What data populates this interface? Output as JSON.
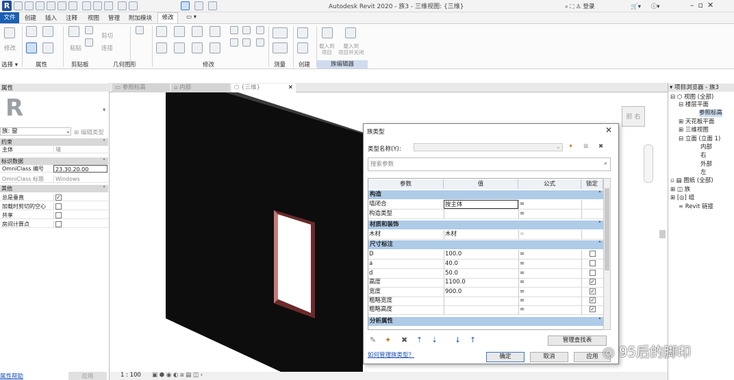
{
  "app": {
    "title": "Autodesk Revit 2020 - 族3 - 三维视图: {三维}",
    "user": "登录"
  },
  "menu": {
    "file": "文件",
    "items": [
      "创建",
      "插入",
      "注释",
      "视图",
      "管理",
      "附加模块"
    ],
    "active": "修改"
  },
  "ribbon": {
    "groups": [
      "选择",
      "属性",
      "剪贴板",
      "几何图形",
      "修改",
      "测量",
      "创建",
      "族编辑器"
    ],
    "labels": {
      "modify": "修改",
      "paste": "粘贴",
      "cut": "剪切",
      "join": "连接",
      "load_project": "载入到\n项目",
      "load_close": "载入到\n项目并关闭"
    }
  },
  "properties": {
    "header": "属性",
    "type_selector": "族: 窗",
    "edit_type": "编辑类型",
    "groups": [
      {
        "name": "约束",
        "rows": [
          {
            "k": "主体",
            "v": "墙"
          }
        ]
      },
      {
        "name": "标识数据",
        "rows": [
          {
            "k": "OmniClass 编号",
            "v": "23.30.20.00"
          },
          {
            "k": "OmniClass 标题",
            "v": "Windows"
          }
        ]
      },
      {
        "name": "其他",
        "rows": [
          {
            "k": "总是垂直",
            "v": "checked"
          },
          {
            "k": "加载时剪切的空心",
            "v": ""
          },
          {
            "k": "共享",
            "v": ""
          },
          {
            "k": "房间计算点",
            "v": ""
          }
        ]
      }
    ],
    "help": "属性帮助",
    "apply": "应用"
  },
  "view_tabs": [
    "参照标高",
    "内部",
    "{三维}"
  ],
  "status": {
    "scale": "1 : 100"
  },
  "project_browser": {
    "header": "项目浏览器 - 族3",
    "nodes": [
      "视图 (全部)",
      "楼层平面",
      "参照标高",
      "天花板平面",
      "三维视图",
      "立面 (立面 1)",
      "内部",
      "右",
      "外部",
      "左",
      "图纸 (全部)",
      "族",
      "组",
      "Revit 链接"
    ]
  },
  "dialog": {
    "title": "族类型",
    "type_name_label": "类型名称(Y):",
    "search_placeholder": "搜索参数",
    "columns": [
      "参数",
      "值",
      "公式",
      "锁定"
    ],
    "sections": [
      {
        "name": "构造",
        "rows": [
          {
            "p": "墙闭合",
            "v": "按主体",
            "f": "=",
            "lock": null
          },
          {
            "p": "构造类型",
            "v": "",
            "f": "=",
            "lock": null
          }
        ]
      },
      {
        "name": "材质和装饰",
        "rows": [
          {
            "p": "木材",
            "v": "木材",
            "f": "=",
            "lock": null
          }
        ]
      },
      {
        "name": "尺寸标注",
        "rows": [
          {
            "p": "D",
            "v": "100.0",
            "f": "=",
            "lock": false
          },
          {
            "p": "a",
            "v": "40.0",
            "f": "=",
            "lock": false
          },
          {
            "p": "d",
            "v": "50.0",
            "f": "=",
            "lock": false
          },
          {
            "p": "高度",
            "v": "1100.0",
            "f": "=",
            "lock": true
          },
          {
            "p": "宽度",
            "v": "900.0",
            "f": "=",
            "lock": true
          },
          {
            "p": "粗略宽度",
            "v": "",
            "f": "=",
            "lock": true
          },
          {
            "p": "粗略高度",
            "v": "",
            "f": "=",
            "lock": true
          }
        ]
      },
      {
        "name": "分析属性",
        "rows": []
      }
    ],
    "manage_lookup": "管理查找表",
    "help_link": "如何管理族类型？",
    "ok": "确定",
    "cancel": "取消",
    "apply": "应用"
  },
  "viewcube": {
    "front": "前",
    "right": "右"
  },
  "watermark": "95后的脚印"
}
